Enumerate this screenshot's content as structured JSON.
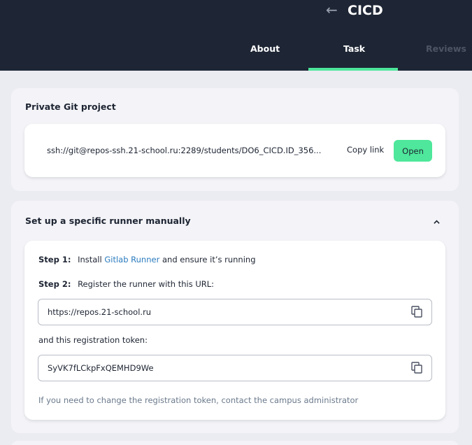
{
  "header": {
    "back_icon": "arrow-left-icon",
    "title": "CICD",
    "tabs": [
      {
        "label": "About",
        "active": false
      },
      {
        "label": "Task",
        "active": true
      },
      {
        "label": "Reviews",
        "active": false
      }
    ],
    "accent_color": "#4ee79b",
    "background_color": "#1e2635"
  },
  "git_project": {
    "title": "Private Git project",
    "url": "ssh://git@repos-ssh.21-school.ru:2289/students/DO6_CICD.ID_356...",
    "copy_link_label": "Copy link",
    "open_label": "Open"
  },
  "runner": {
    "title": "Set up a specific runner manually",
    "expanded": true,
    "step1": {
      "label": "Step 1:",
      "text_before": "Install",
      "link": "Gitlab Runner",
      "text_after": "and ensure it’s running"
    },
    "step2": {
      "label": "Step 2:",
      "text": "Register the runner with this URL:"
    },
    "url_value": "https://repos.21-school.ru",
    "token_label": "and this registration token:",
    "token_value": "SyVK7fLCkpFxQEMHD9We",
    "hint": "If you need to change the registration token, contact the campus administrator",
    "copy_icon": "copy-icon",
    "chevron_icon": "chevron-up-icon"
  }
}
